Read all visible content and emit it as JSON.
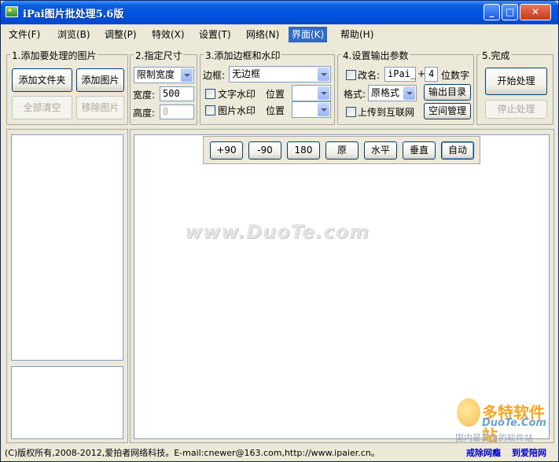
{
  "window": {
    "title": "iPai图片批处理5.6版"
  },
  "menu": [
    "文件(F)",
    "浏览(B)",
    "调整(P)",
    "特效(X)",
    "设置(T)",
    "网络(N)",
    "界面(K)",
    "帮助(H)"
  ],
  "group1": {
    "title": "1.添加要处理的图片",
    "add_folder": "添加文件夹",
    "add_image": "添加图片",
    "clear_all": "全部清空",
    "remove_image": "移除图片"
  },
  "group2": {
    "title": "2.指定尺寸",
    "mode": "限制宽度",
    "width_label": "宽度:",
    "width_value": "500",
    "height_label": "高度:",
    "height_value": "0"
  },
  "group3": {
    "title": "3.添加边框和水印",
    "border_label": "边框:",
    "border_value": "无边框",
    "text_watermark": "文字水印",
    "image_watermark": "图片水印",
    "position1": "位置",
    "position2": "位置"
  },
  "group4": {
    "title": "4.设置输出参数",
    "rename_label": "改名:",
    "rename_prefix": "iPai_",
    "plus": "+",
    "digits": "4",
    "digits_label": "位数字",
    "format_label": "格式:",
    "format_value": "原格式",
    "output_dir": "输出目录",
    "upload_label": "上传到互联网",
    "space_manage": "空间管理"
  },
  "group5": {
    "title": "5.完成",
    "start": "开始处理",
    "stop": "停止处理"
  },
  "rotate": [
    "+90",
    "-90",
    "180",
    "原",
    "水平",
    "垂直",
    "自动"
  ],
  "watermark_text": "www.DuoTe.com",
  "status": {
    "copyright": "(C)版权所有,2008-2012,爱拍者网络科技。E-mail:cnewer@163.com,http://www.ipaier.cn。",
    "link1": "戒除网瘾",
    "link2": "到爱陪网"
  },
  "logo": {
    "t1": "多特软件站",
    "t2": "DuoTe.Com",
    "t3": "国内最安全的软件站"
  }
}
